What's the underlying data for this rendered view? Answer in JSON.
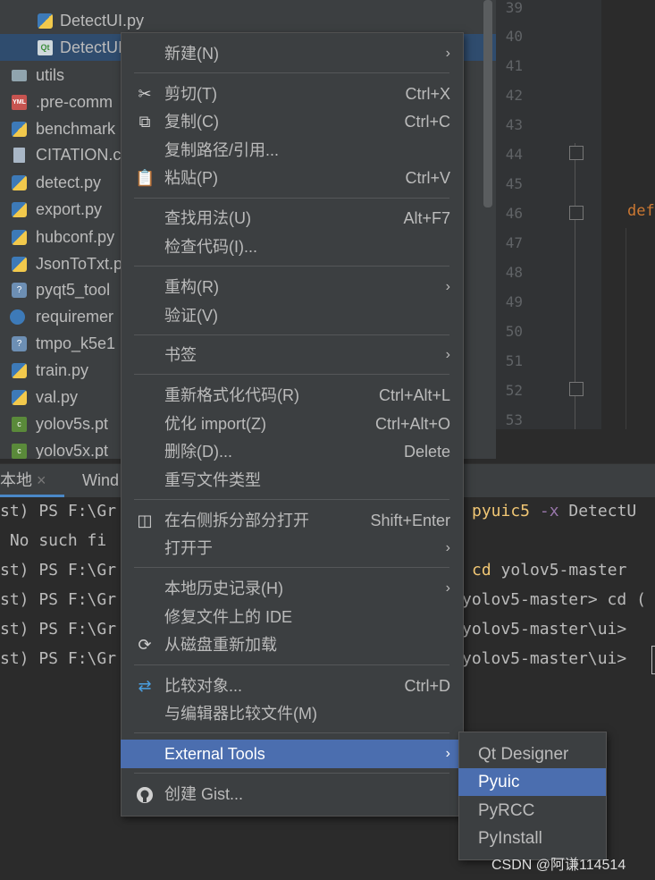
{
  "project_tree": {
    "items": [
      {
        "label": "DetectUI.py",
        "icon": "python-file-icon"
      },
      {
        "label": "DetectUI",
        "icon": "qt-ui-file-icon",
        "selected": true
      },
      {
        "label": "utils",
        "icon": "folder-icon"
      },
      {
        "label": ".pre-comm",
        "icon": "yml-file-icon"
      },
      {
        "label": "benchmark",
        "icon": "python-file-icon"
      },
      {
        "label": "CITATION.c",
        "icon": "text-file-icon"
      },
      {
        "label": "detect.py",
        "icon": "python-file-icon"
      },
      {
        "label": "export.py",
        "icon": "python-file-icon"
      },
      {
        "label": "hubconf.py",
        "icon": "python-file-icon"
      },
      {
        "label": "JsonToTxt.p",
        "icon": "python-file-icon"
      },
      {
        "label": "pyqt5_tool",
        "icon": "unknown-python-file-icon"
      },
      {
        "label": "requiremer",
        "icon": "requirements-file-icon"
      },
      {
        "label": "tmpo_k5e1",
        "icon": "unknown-python-file-icon"
      },
      {
        "label": "train.py",
        "icon": "python-file-icon"
      },
      {
        "label": "val.py",
        "icon": "python-file-icon"
      },
      {
        "label": "yolov5s.pt",
        "icon": "pt-file-icon"
      },
      {
        "label": "yolov5x.pt",
        "icon": "pt-file-icon"
      }
    ]
  },
  "editor": {
    "line_numbers": [
      "39",
      "40",
      "41",
      "42",
      "43",
      "44",
      "45",
      "46",
      "47",
      "48",
      "49",
      "50",
      "51",
      "52",
      "53"
    ],
    "code_fragment": "def"
  },
  "bottom_tabs": {
    "local": "本地",
    "local_close": "×",
    "windows": "Wind"
  },
  "terminal": {
    "lines": [
      {
        "left": "st) PS F:\\Gr",
        "right_cmd": "pyuic5",
        "right_flag": " -x",
        "right_rest": " DetectU"
      },
      {
        "left": " No such fi",
        "right_cmd": "",
        "right_flag": "",
        "right_rest": ""
      },
      {
        "left": "st) PS F:\\Gr",
        "right_cmd": "cd",
        "right_flag": "",
        "right_rest": " yolov5-master"
      },
      {
        "left": "st) PS F:\\Gr",
        "right_cmd": "",
        "right_flag": "",
        "right_rest": "yolov5-master> cd ("
      },
      {
        "left": "st) PS F:\\Gr",
        "right_cmd": "",
        "right_flag": "",
        "right_rest": "yolov5-master\\ui> "
      },
      {
        "left": "st) PS F:\\Gr",
        "right_cmd": "",
        "right_flag": "",
        "right_rest": "yolov5-master\\ui> "
      }
    ]
  },
  "context_menu": {
    "items": [
      {
        "label": "新建(N)",
        "submenu": true
      },
      {
        "label": "剪切(T)",
        "shortcut": "Ctrl+X",
        "icon": "scissors-icon"
      },
      {
        "label": "复制(C)",
        "shortcut": "Ctrl+C",
        "icon": "copy-icon"
      },
      {
        "label": "复制路径/引用..."
      },
      {
        "label": "粘贴(P)",
        "shortcut": "Ctrl+V",
        "icon": "paste-icon"
      },
      {
        "label": "查找用法(U)",
        "shortcut": "Alt+F7"
      },
      {
        "label": "检查代码(I)..."
      },
      {
        "label": "重构(R)",
        "submenu": true
      },
      {
        "label": "验证(V)"
      },
      {
        "label": "书签",
        "submenu": true
      },
      {
        "label": "重新格式化代码(R)",
        "shortcut": "Ctrl+Alt+L"
      },
      {
        "label": "优化 import(Z)",
        "shortcut": "Ctrl+Alt+O"
      },
      {
        "label": "删除(D)...",
        "shortcut": "Delete"
      },
      {
        "label": "重写文件类型"
      },
      {
        "label": "在右侧拆分部分打开",
        "shortcut": "Shift+Enter",
        "icon": "split-icon"
      },
      {
        "label": "打开于",
        "submenu": true
      },
      {
        "label": "本地历史记录(H)",
        "submenu": true
      },
      {
        "label": "修复文件上的 IDE"
      },
      {
        "label": "从磁盘重新加载",
        "icon": "reload-icon"
      },
      {
        "label": "比较对象...",
        "shortcut": "Ctrl+D",
        "icon": "compare-icon"
      },
      {
        "label": "与编辑器比较文件(M)"
      },
      {
        "label": "External Tools",
        "submenu": true,
        "highlighted": true
      },
      {
        "label": "创建 Gist...",
        "icon": "github-icon"
      }
    ],
    "arrow_glyph": "›"
  },
  "external_tools_submenu": {
    "items": [
      "Qt Designer",
      "Pyuic",
      "PyRCC",
      "PyInstall"
    ],
    "highlighted": "Pyuic"
  },
  "watermark": "CSDN @阿谦114514",
  "colors": {
    "highlight": "#4b6eaf",
    "selection": "#2f4c6e",
    "menu_bg": "#3c3f41",
    "editor_bg": "#2b2b2b"
  }
}
